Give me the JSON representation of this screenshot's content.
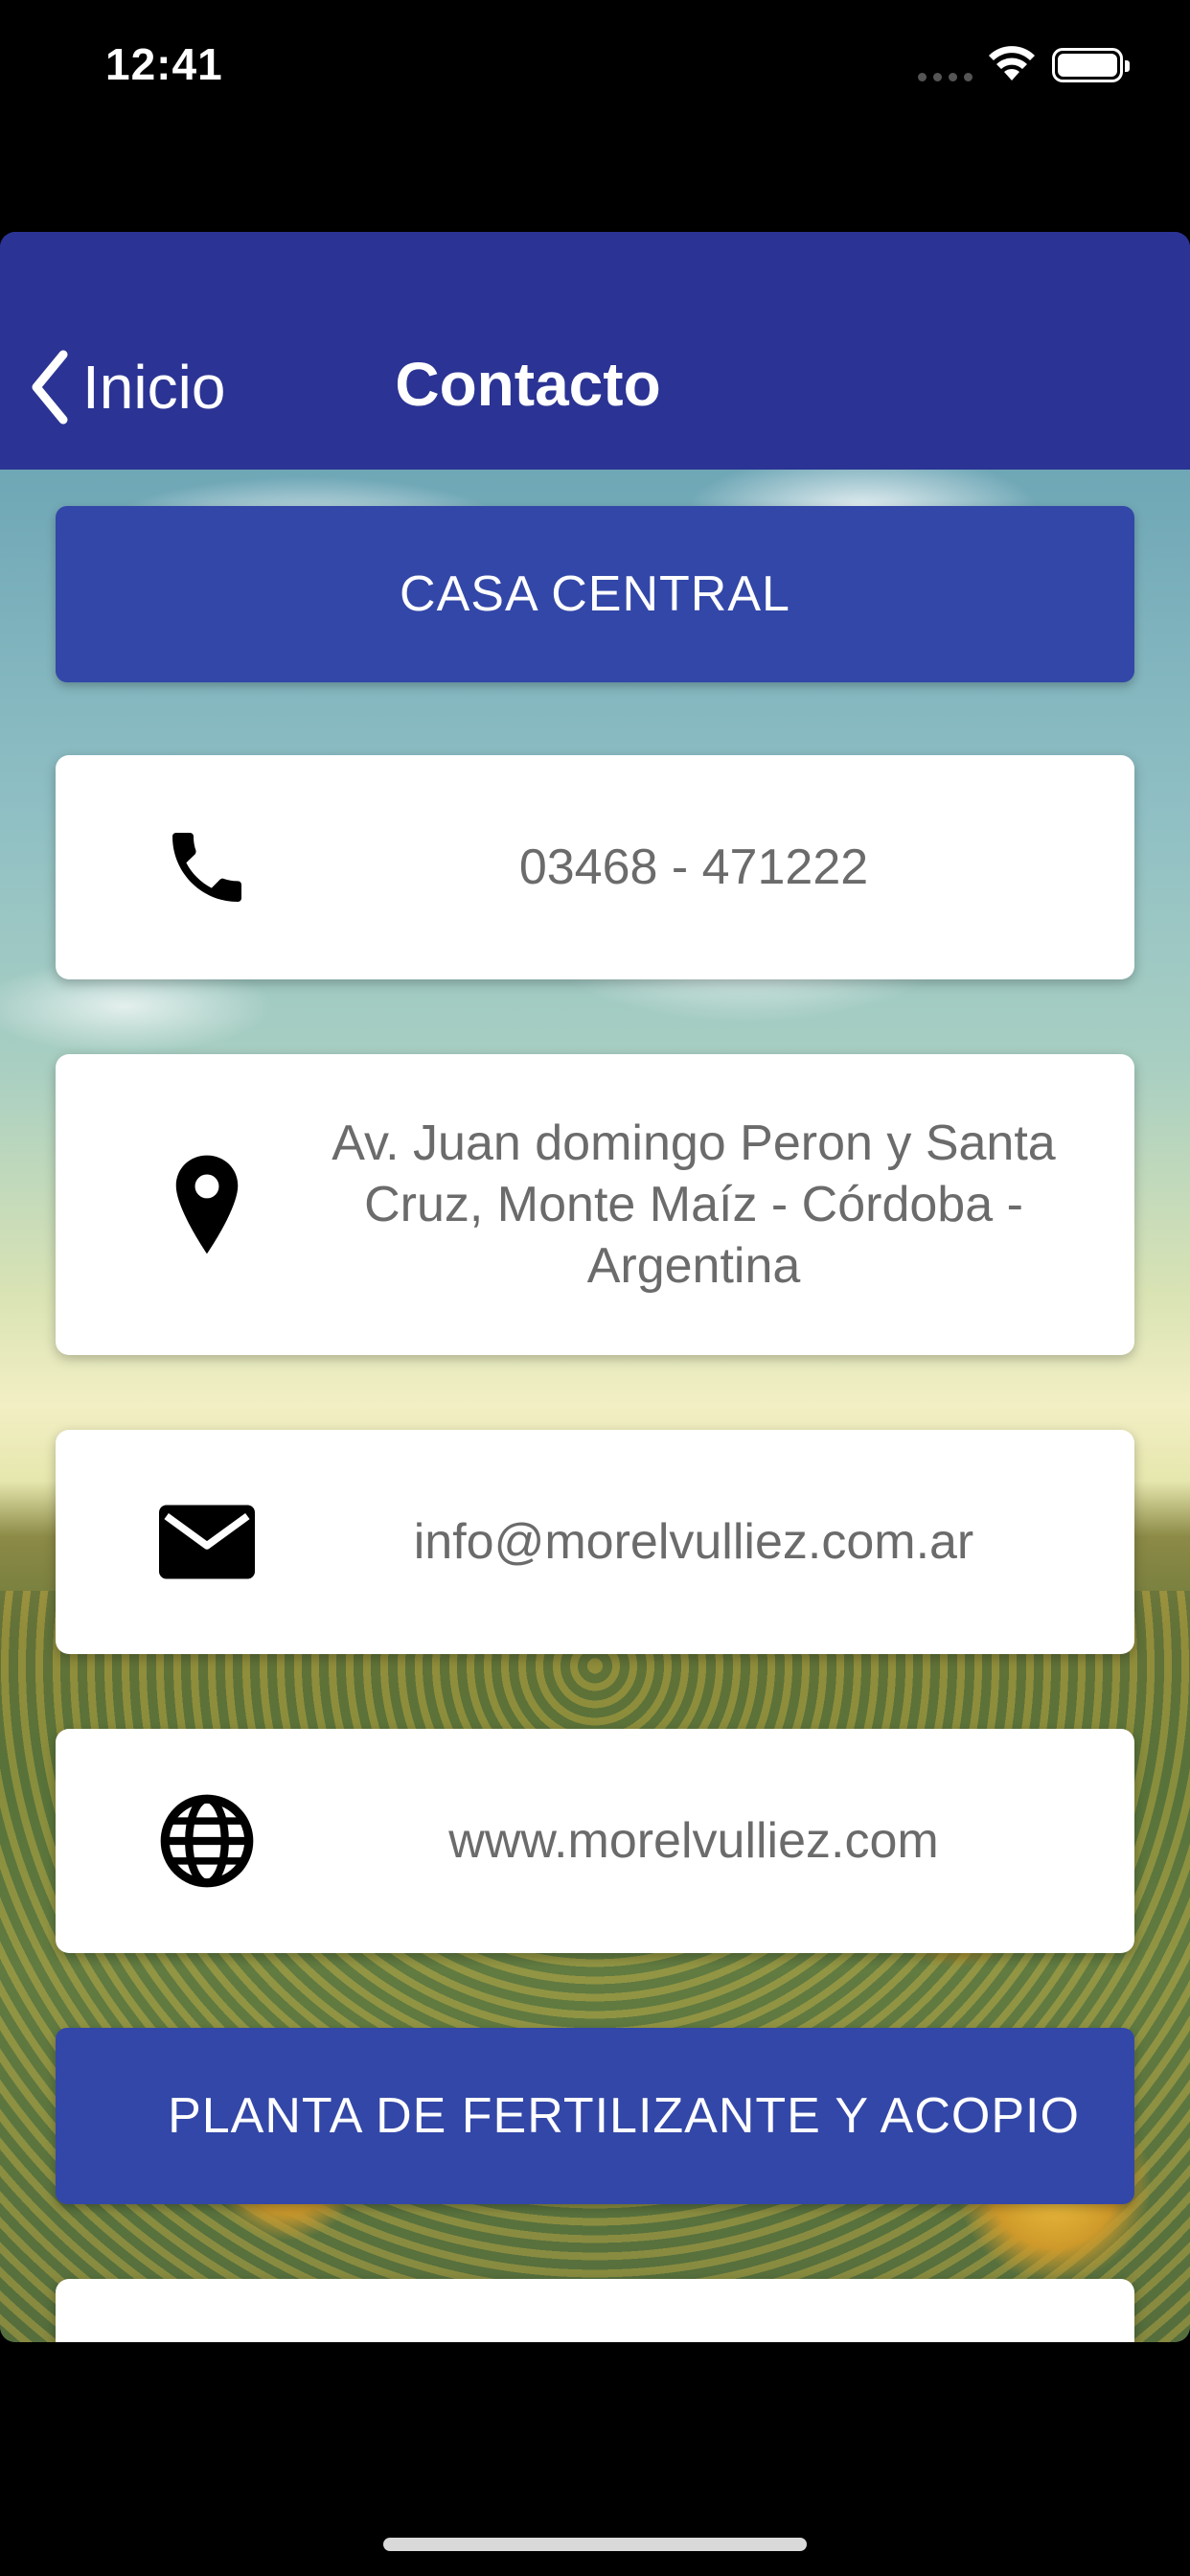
{
  "status_bar": {
    "time": "12:41"
  },
  "nav": {
    "back_label": "Inicio",
    "title": "Contacto"
  },
  "sections": [
    {
      "header": "CASA CENTRAL",
      "items": [
        {
          "icon": "phone-icon",
          "text": "03468 - 471222"
        },
        {
          "icon": "location-pin-icon",
          "text": "Av. Juan domingo Peron y Santa Cruz, Monte Maíz - Córdoba - Argentina"
        },
        {
          "icon": "mail-icon",
          "text": "info@morelvulliez.com.ar"
        },
        {
          "icon": "globe-icon",
          "text": "www.morelvulliez.com"
        }
      ]
    },
    {
      "header": "PLANTA DE FERTILIZANTE Y ACOPIO",
      "items": [
        {
          "icon": "phone-icon",
          "text": ""
        }
      ]
    }
  ],
  "colors": {
    "nav_background": "#2b3494",
    "section_header": "#3347a8",
    "card_text": "#6b6b6b"
  }
}
